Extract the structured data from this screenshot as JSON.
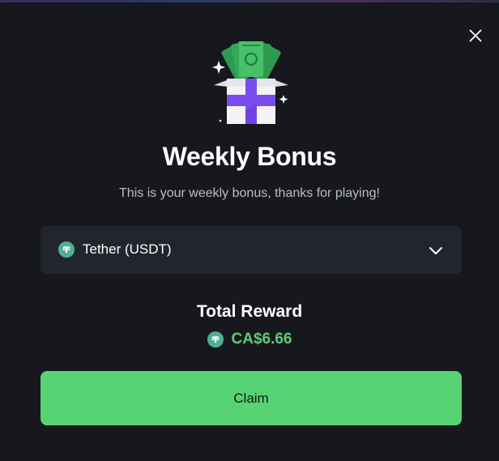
{
  "modal": {
    "close_icon": "close-icon",
    "illustration": "gift-box-with-cash-icon",
    "title": "Weekly Bonus",
    "subtitle": "This is your weekly bonus, thanks for playing!"
  },
  "currency_select": {
    "selected": "Tether (USDT)",
    "icon": "tether-icon",
    "chevron_icon": "chevron-down-icon"
  },
  "reward": {
    "label": "Total Reward",
    "value": "CA$6.66",
    "icon": "tether-icon"
  },
  "claim_button": {
    "label": "Claim"
  },
  "colors": {
    "background": "#17181d",
    "panel": "#23252e",
    "accent_green": "#57d374",
    "reward_green": "#5ecb74",
    "tether": "#50af95",
    "gift_purple": "#7b4cf0"
  }
}
